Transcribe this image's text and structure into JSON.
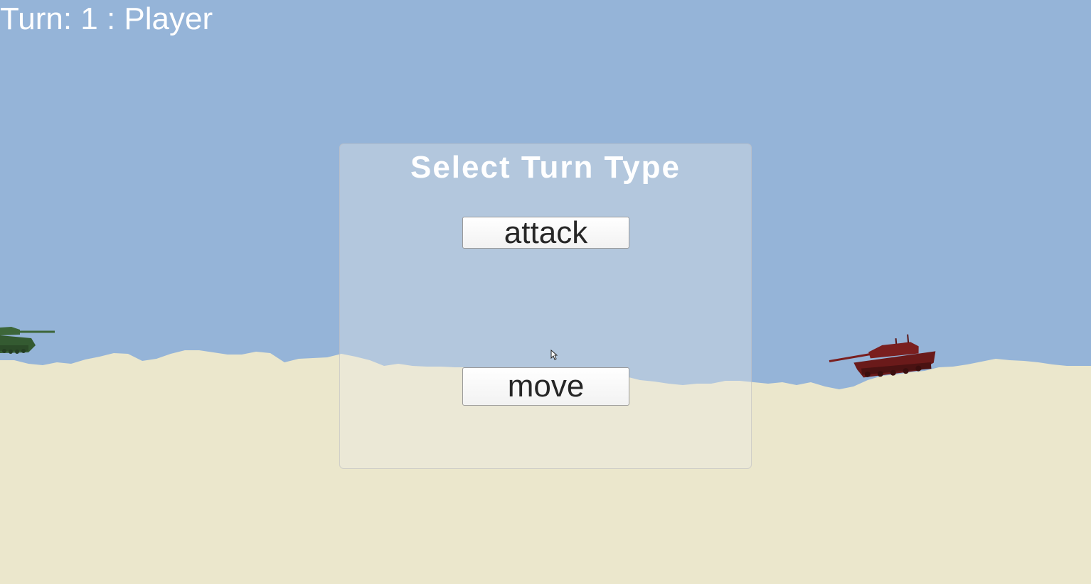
{
  "hud": {
    "turn_text": "Turn: 1 : Player"
  },
  "turn_panel": {
    "title": "Select Turn Type",
    "attack_label": "attack",
    "move_label": "move"
  },
  "colors": {
    "sky": "#95b4d8",
    "ground": "#ebe7cc",
    "player_tank": "#3d6639",
    "enemy_tank": "#7a1f1f",
    "text": "#ffffff"
  },
  "icons": {
    "cursor": "mouse-cursor-icon",
    "player_tank": "player-tank-icon",
    "enemy_tank": "enemy-tank-icon"
  }
}
